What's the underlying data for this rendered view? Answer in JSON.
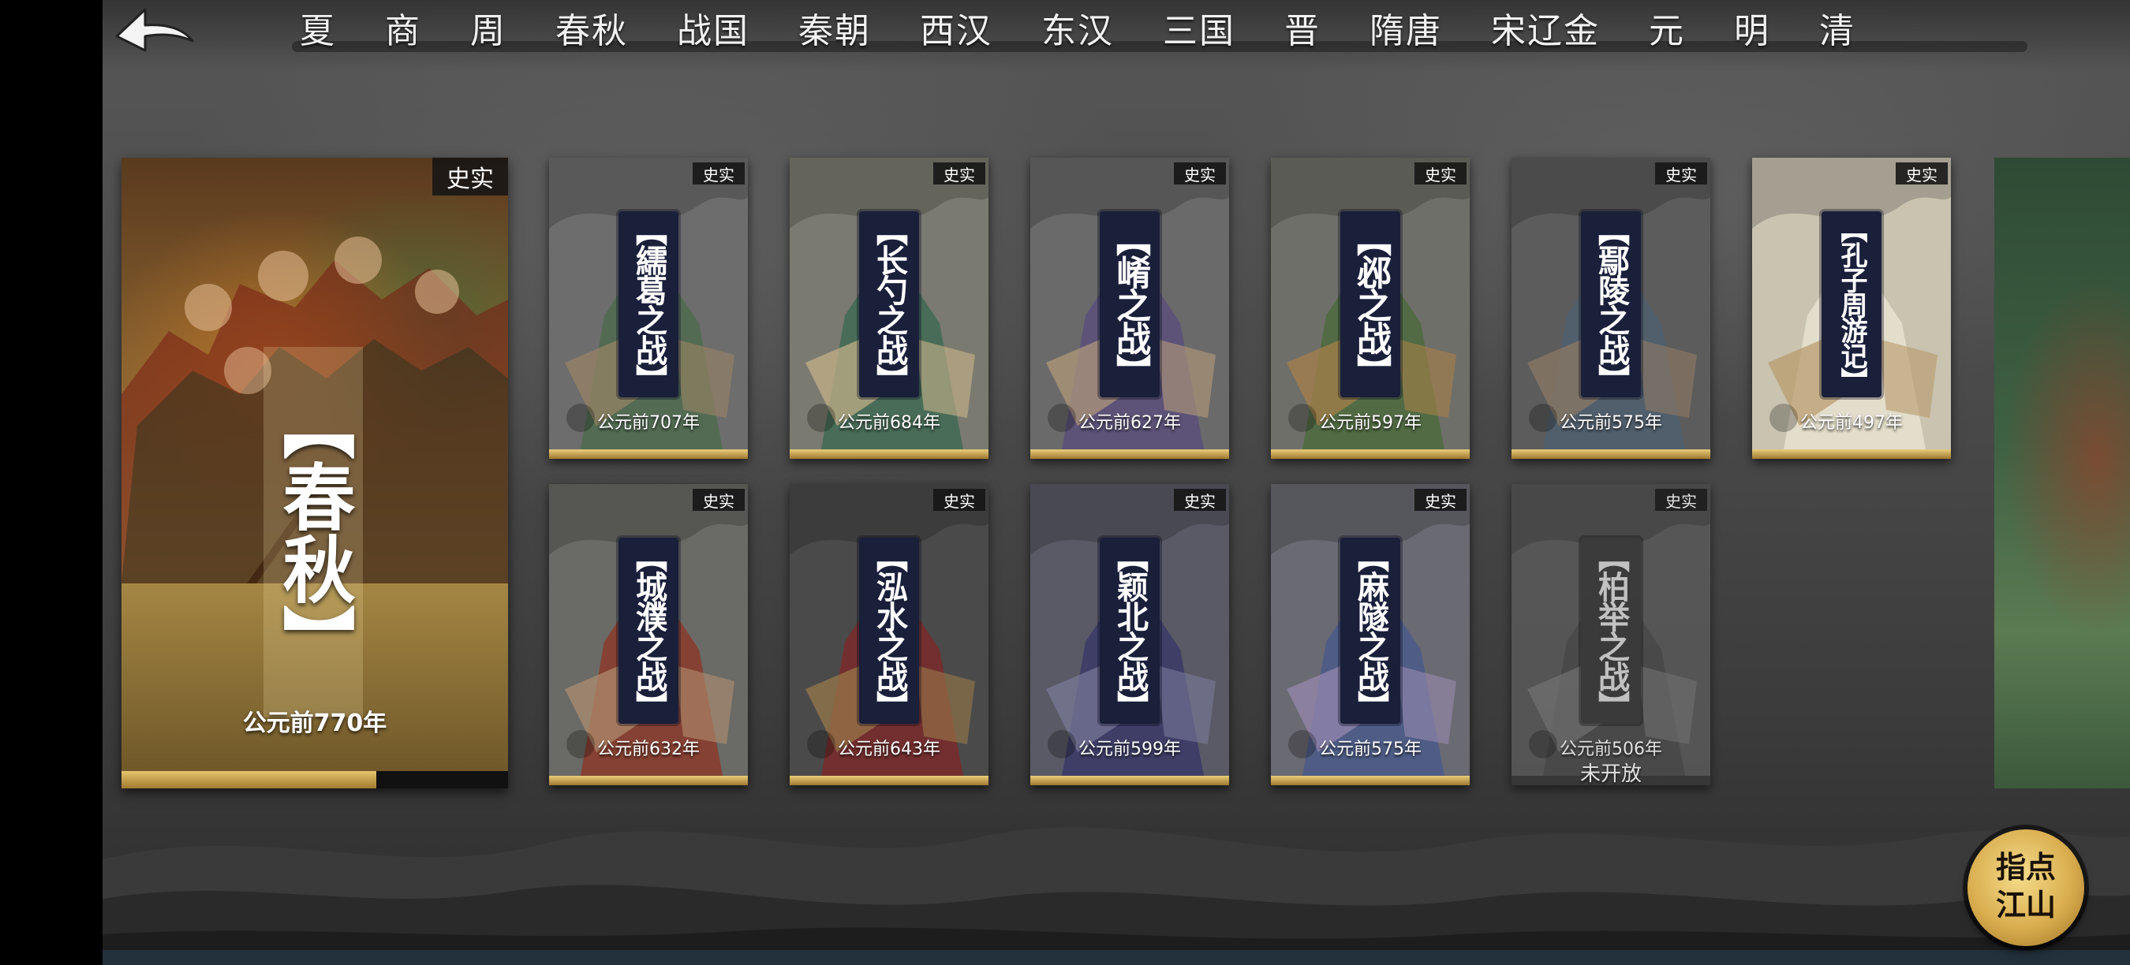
{
  "nav": {
    "back_icon": "back-arrow-icon",
    "dynasties": [
      "夏",
      "商",
      "周",
      "春秋",
      "战国",
      "秦朝",
      "西汉",
      "东汉",
      "三国",
      "晋",
      "隋唐",
      "宋辽金",
      "元",
      "明",
      "清"
    ]
  },
  "featured": {
    "tag": "史实",
    "title": "【春秋】",
    "date": "公元前770年",
    "progress": 0.66,
    "accent": "#c9a24a"
  },
  "cards": [
    {
      "tag": "史实",
      "title": "【繻葛之战】",
      "date": "公元前707年",
      "locked": false,
      "status": ""
    },
    {
      "tag": "史实",
      "title": "【长勺之战】",
      "date": "公元前684年",
      "locked": false,
      "status": ""
    },
    {
      "tag": "史实",
      "title": "【崤之战】",
      "date": "公元前627年",
      "locked": false,
      "status": ""
    },
    {
      "tag": "史实",
      "title": "【邲之战】",
      "date": "公元前597年",
      "locked": false,
      "status": ""
    },
    {
      "tag": "史实",
      "title": "【鄢陵之战】",
      "date": "公元前575年",
      "locked": false,
      "status": ""
    },
    {
      "tag": "史实",
      "title": "【孔子周游记】",
      "date": "公元前497年",
      "locked": false,
      "status": ""
    },
    {
      "tag": "史实",
      "title": "【城濮之战】",
      "date": "公元前632年",
      "locked": false,
      "status": ""
    },
    {
      "tag": "史实",
      "title": "【泓水之战】",
      "date": "公元前643年",
      "locked": false,
      "status": ""
    },
    {
      "tag": "史实",
      "title": "【颖北之战】",
      "date": "公元前599年",
      "locked": false,
      "status": ""
    },
    {
      "tag": "史实",
      "title": "【麻隧之战】",
      "date": "公元前575年",
      "locked": false,
      "status": ""
    },
    {
      "tag": "史实",
      "title": "【柏举之战】",
      "date": "公元前506年",
      "locked": true,
      "status": "未开放"
    }
  ],
  "guide_button": {
    "label_line1": "指点",
    "label_line2": "江山"
  },
  "colors": {
    "title_plate": "#1a1f3a",
    "gold": "#d4b060"
  }
}
